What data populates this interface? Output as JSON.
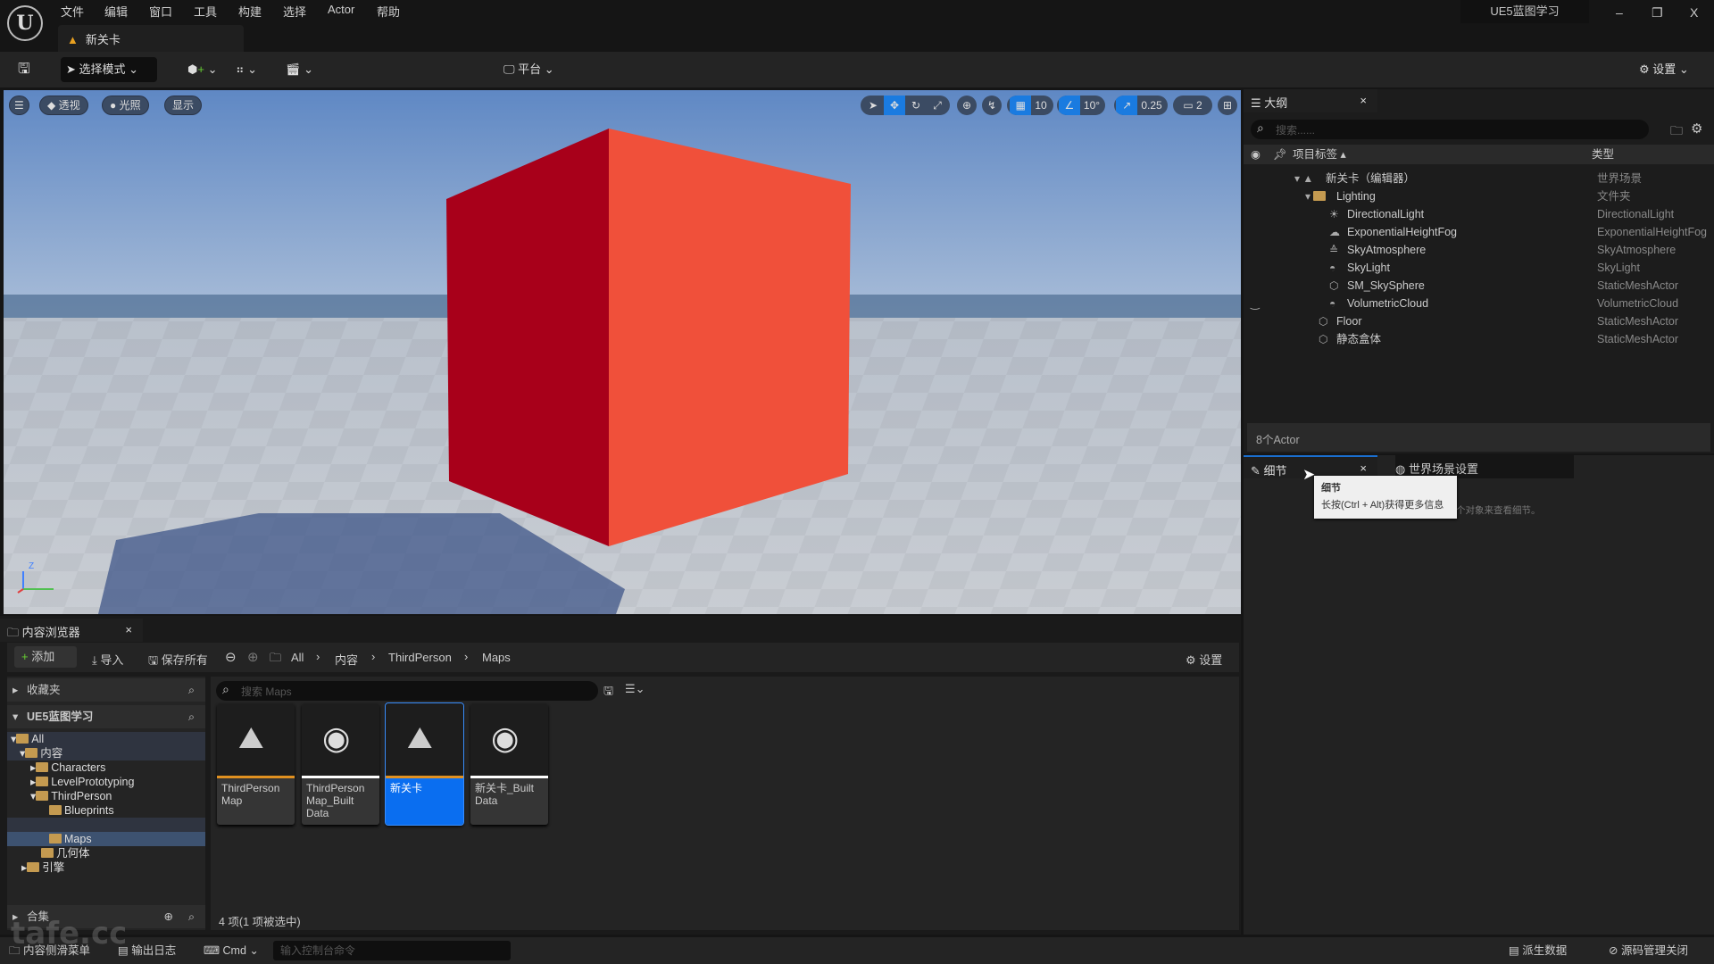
{
  "menu": {
    "logo": "U",
    "items": [
      "文件",
      "编辑",
      "窗口",
      "工具",
      "构建",
      "选择",
      "Actor",
      "帮助"
    ],
    "project": "UE5蓝图学习",
    "window_controls": [
      "–",
      "❐",
      "X"
    ]
  },
  "doc_tab": {
    "label": "新关卡"
  },
  "toolbar": {
    "mode": "选择模式",
    "platform": "平台",
    "settings": "设置"
  },
  "viewport": {
    "menu": "☰",
    "perspective": "透视",
    "lighting": "光照",
    "show": "显示",
    "grid_snap": "10",
    "rotation_snap": "10°",
    "scale_snap": "0.25",
    "camera_speed": "2",
    "axis": {
      "z": "Z",
      "x": "x",
      "y": "y"
    },
    "cube_color": "#e8382c"
  },
  "outliner": {
    "title": "大纲",
    "search_placeholder": "搜索......",
    "col_label": "项目标签",
    "col_type": "类型",
    "items": [
      {
        "label": "新关卡（编辑器）",
        "type": "世界场景",
        "icon": "level-icon"
      },
      {
        "label": "Lighting",
        "type": "文件夹",
        "icon": "folder-icon"
      },
      {
        "label": "DirectionalLight",
        "type": "DirectionalLight",
        "icon": "sun-icon"
      },
      {
        "label": "ExponentialHeightFog",
        "type": "ExponentialHeightFog",
        "icon": "fog-icon"
      },
      {
        "label": "SkyAtmosphere",
        "type": "SkyAtmosphere",
        "icon": "atmosphere-icon"
      },
      {
        "label": "SkyLight",
        "type": "SkyLight",
        "icon": "skylight-icon"
      },
      {
        "label": "SM_SkySphere",
        "type": "StaticMeshActor",
        "icon": "mesh-icon"
      },
      {
        "label": "VolumetricCloud",
        "type": "VolumetricCloud",
        "icon": "cloud-icon"
      },
      {
        "label": "Floor",
        "type": "StaticMeshActor",
        "icon": "mesh-icon"
      },
      {
        "label": "静态盒体",
        "type": "StaticMeshActor",
        "icon": "mesh-icon"
      }
    ],
    "count": "8个Actor"
  },
  "details": {
    "tab": "细节",
    "world_tab": "世界场景设置",
    "hint": "个对象来查看细节。",
    "tooltip_title": "细节",
    "tooltip_body": "长按(Ctrl + Alt)获得更多信息"
  },
  "content_browser": {
    "title": "内容浏览器",
    "add": "添加",
    "import": "导入",
    "save_all": "保存所有",
    "breadcrumb": [
      "All",
      "内容",
      "ThirdPerson",
      "Maps"
    ],
    "settings": "设置",
    "favorites": "收藏夹",
    "project": "UE5蓝图学习",
    "collections": "合集",
    "tree": [
      "All",
      "内容",
      "Characters",
      "LevelPrototyping",
      "ThirdPerson",
      "Blueprints",
      "Maps",
      "几何体",
      "引擎"
    ],
    "search_placeholder": "搜索 Maps",
    "assets": [
      {
        "name": "ThirdPerson Map",
        "kind": "level",
        "bar": "#e09020",
        "selected": false
      },
      {
        "name": "ThirdPerson Map_Built Data",
        "kind": "data",
        "bar": "#ffffff",
        "selected": false
      },
      {
        "name": "新关卡",
        "kind": "level",
        "bar": "#e09020",
        "selected": true
      },
      {
        "name": "新关卡_Built Data",
        "kind": "data",
        "bar": "#ffffff",
        "selected": false
      }
    ],
    "status": "4 项(1 项被选中)"
  },
  "statusbar": {
    "drawer": "内容侧滑菜单",
    "output_log": "输出日志",
    "cmd": "Cmd",
    "console_placeholder": "输入控制台命令",
    "derived_data": "派生数据",
    "source_control": "源码管理关闭"
  },
  "watermark": "tafe.cc"
}
